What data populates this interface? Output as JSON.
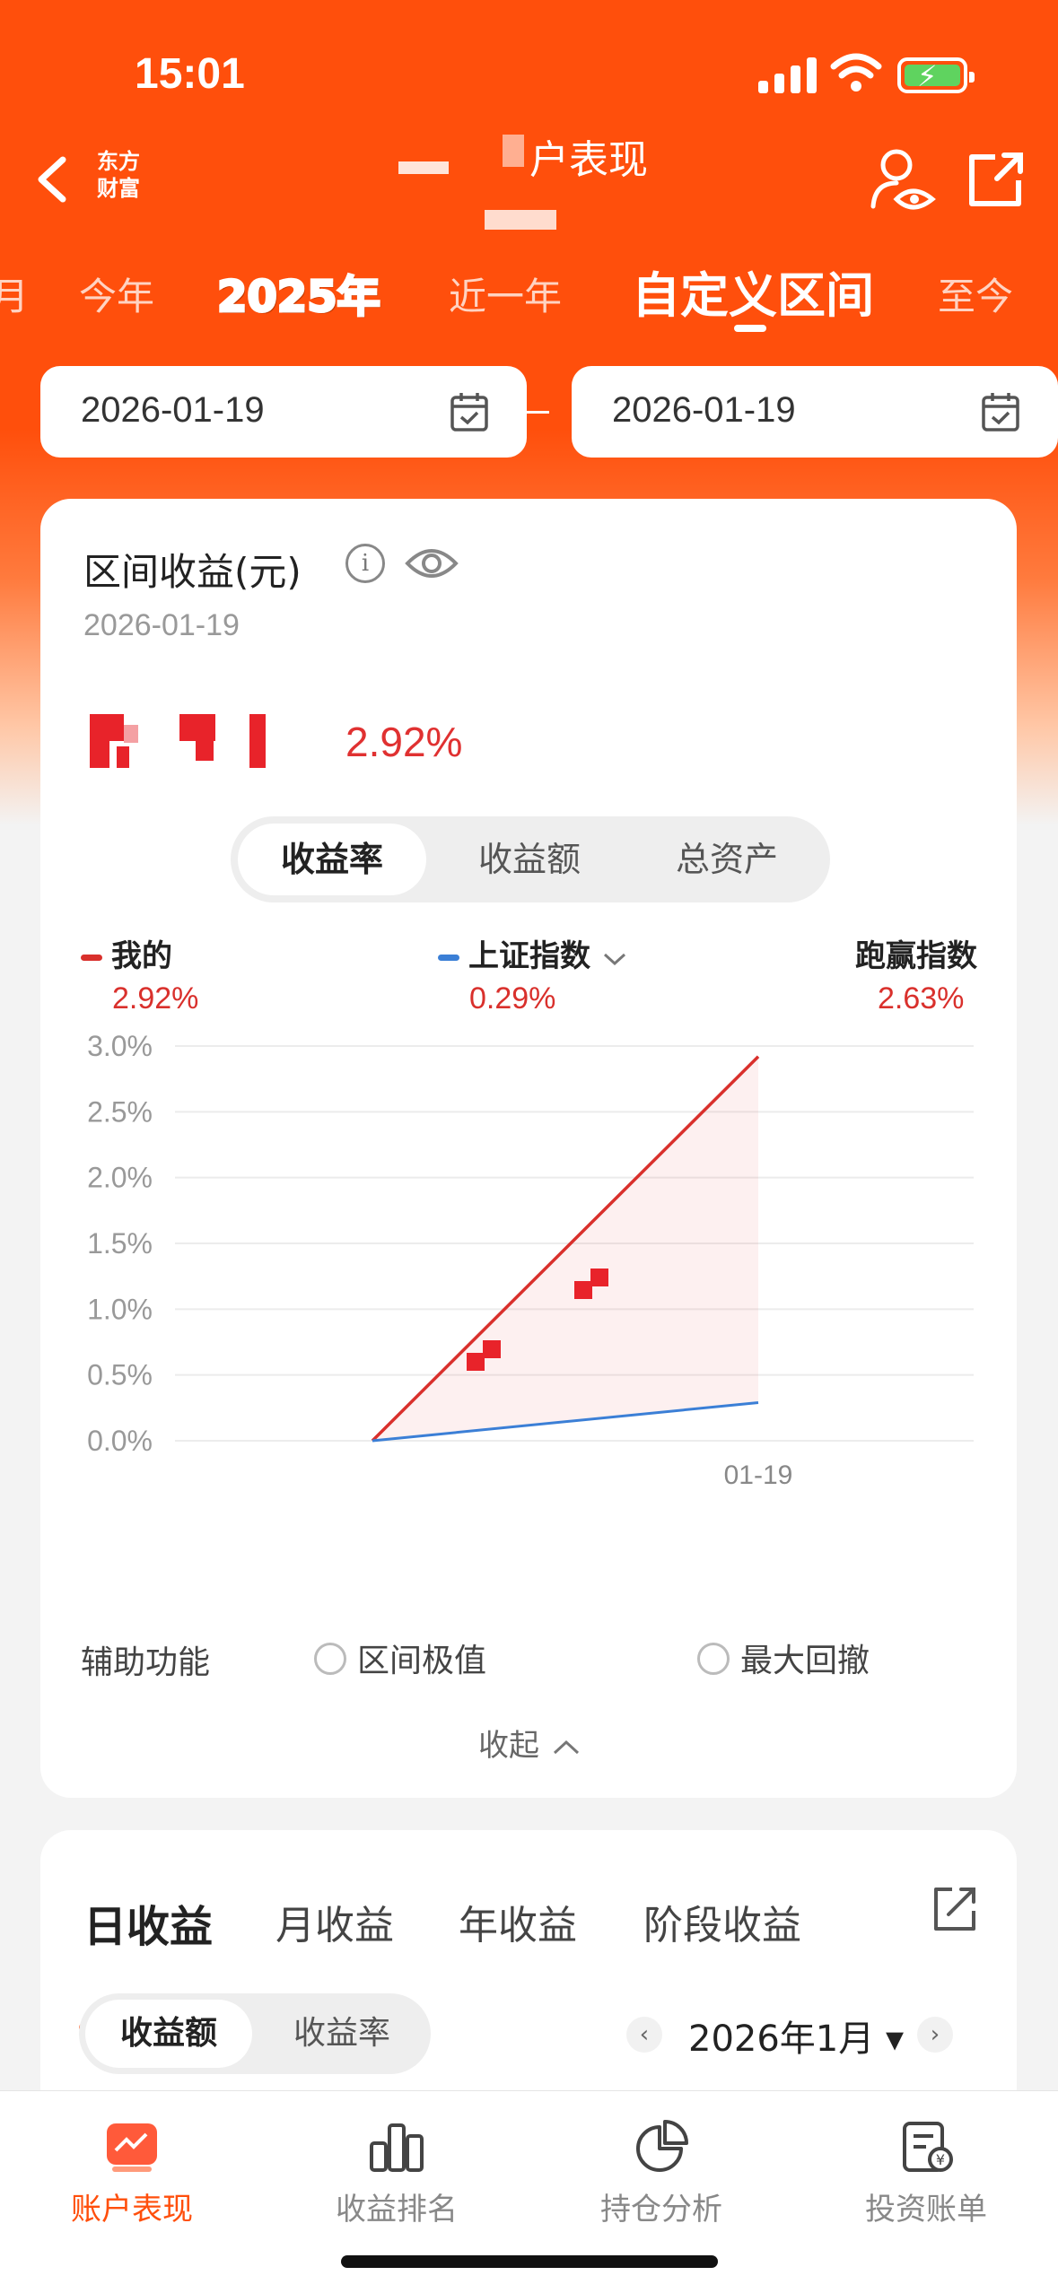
{
  "status": {
    "time": "15:01"
  },
  "nav": {
    "logo_line1": "东方",
    "logo_line2": "财富",
    "title_visible": "户表现"
  },
  "period_tabs": [
    "今年",
    "2025年",
    "近一年",
    "自定义区间",
    "至今"
  ],
  "date_range": {
    "start": "2026-01-19",
    "end": "2026-01-19"
  },
  "summary": {
    "title": "区间收益(元)",
    "date": "2026-01-19",
    "rate": "2.92%"
  },
  "metric_tabs": [
    "收益率",
    "收益额",
    "总资产"
  ],
  "legend": {
    "mine_label": "我的",
    "mine_value": "2.92%",
    "index_label": "上证指数",
    "index_value": "0.29%",
    "beat_label": "跑赢指数",
    "beat_value": "2.63%"
  },
  "chart_data": {
    "type": "line",
    "x_tick": "01-19",
    "y_ticks": [
      "3.0%",
      "2.5%",
      "2.0%",
      "1.5%",
      "1.0%",
      "0.5%",
      "0.0%"
    ],
    "ylim": [
      0,
      3.0
    ],
    "series": [
      {
        "name": "我的",
        "color": "#d9302c",
        "values": [
          0.0,
          2.92
        ]
      },
      {
        "name": "上证指数",
        "color": "#3b7fd6",
        "values": [
          0.0,
          0.29
        ]
      }
    ]
  },
  "aux": {
    "label": "辅助功能",
    "opt1": "区间极值",
    "opt2": "最大回撤",
    "collapse": "收起"
  },
  "earnings": {
    "tabs": [
      "日收益",
      "月收益",
      "年收益",
      "阶段收益"
    ],
    "segment": [
      "收益额",
      "收益率"
    ],
    "month": "2026年1月"
  },
  "bottom_nav": [
    "账户表现",
    "收益排名",
    "持仓分析",
    "投资账单"
  ],
  "colors": {
    "brand": "#ff4f0c",
    "red": "#d9302c",
    "blue": "#3b7fd6"
  }
}
